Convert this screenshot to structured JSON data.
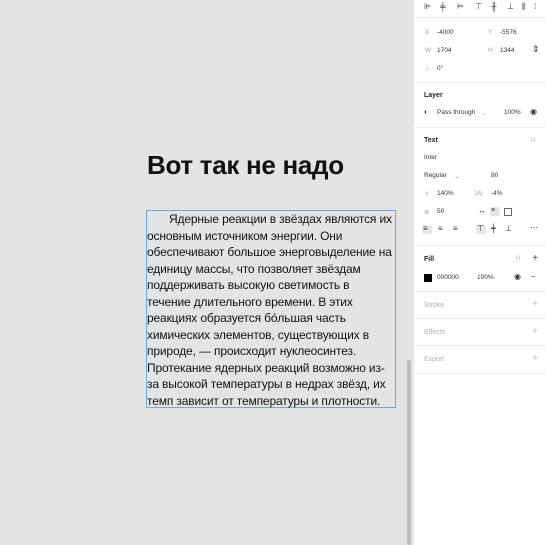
{
  "canvas": {
    "heading": "Вот так не надо",
    "paragraph": "Ядерные реакции в звёздах являются их основным источником энергии. Они обеспечивают большое энерговыделение на единицу массы, что позволяет звёздам поддерживать высокую светимость в течение длительного времени. В этих реакциях образуется бо́льшая часть химических элементов, существующих в природе, — происходит нуклеосинтез. Протекание ядерных реакций возможно из-за высокой температуры в недрах звёзд, их темп зависит от температуры и плотности."
  },
  "panel": {
    "alignment_icons": [
      "align-left-icon",
      "align-center-h-icon",
      "align-right-icon",
      "align-top-icon",
      "align-middle-v-icon",
      "align-bottom-icon",
      "distribute-icon",
      "more-align-icon"
    ],
    "position": {
      "x_label": "X",
      "x_value": "-4000",
      "y_label": "Y",
      "y_value": "-5576",
      "w_label": "W",
      "w_value": "1704",
      "h_label": "H",
      "h_value": "1344",
      "rotation_value": "0°"
    },
    "layer": {
      "title": "Layer",
      "blend_mode": "Pass through",
      "opacity": "100%"
    },
    "text": {
      "title": "Text",
      "font_family": "Inter",
      "font_style": "Regular",
      "font_size": "80",
      "line_height": "140%",
      "letter_spacing": "-4%",
      "paragraph_spacing": "50"
    },
    "fill": {
      "title": "Fill",
      "hex": "000000",
      "opacity": "100%",
      "swatch_color": "#000000"
    },
    "stroke": {
      "title": "Stroke"
    },
    "effects": {
      "title": "Effects"
    },
    "export": {
      "title": "Export"
    }
  },
  "colors": {
    "canvas_bg": "#e4e4e4",
    "selection": "#6aa9e3",
    "panel_bg": "#ffffff"
  }
}
